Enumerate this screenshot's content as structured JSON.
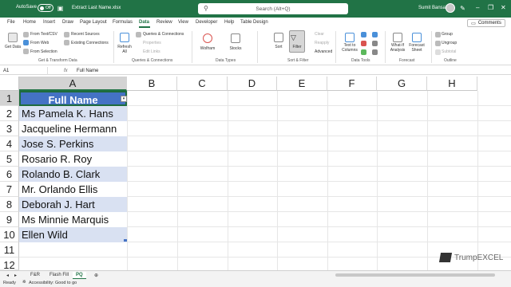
{
  "titlebar": {
    "autosave_label": "AutoSave",
    "autosave_state": "Off",
    "filename": "Extract Last Name.xlsx",
    "search_placeholder": "Search (Alt+Q)",
    "user_name": "Sumit Bansal",
    "accent": "#217346"
  },
  "tabs": [
    "File",
    "Home",
    "Insert",
    "Draw",
    "Page Layout",
    "Formulas",
    "Data",
    "Review",
    "View",
    "Developer",
    "Help",
    "Table Design"
  ],
  "active_tab": "Data",
  "comments_label": "Comments",
  "ribbon": {
    "get_data": "Get Data",
    "from_text_csv": "From Text/CSV",
    "from_web": "From Web",
    "from_selection": "From Selection",
    "recent_sources": "Recent Sources",
    "existing_connections": "Existing Connections",
    "group_get_transform": "Get & Transform Data",
    "refresh_all": "Refresh All",
    "queries_connections": "Queries & Connections",
    "properties": "Properties",
    "edit_links": "Edit Links",
    "group_queries": "Queries & Connections",
    "wolfram": "Wolfram",
    "stocks": "Stocks",
    "group_data_types": "Data Types",
    "sort": "Sort",
    "filter": "Filter",
    "clear": "Clear",
    "reapply": "Reapply",
    "advanced": "Advanced",
    "group_sort_filter": "Sort & Filter",
    "text_to_columns": "Text to Columns",
    "group_data_tools": "Data Tools",
    "what_if": "What-If Analysis",
    "forecast_sheet": "Forecast Sheet",
    "group_forecast": "Forecast",
    "group": "Group",
    "ungroup": "Ungroup",
    "subtotal": "Subtotal",
    "group_outline": "Outline"
  },
  "formula_bar": {
    "name_box": "A1",
    "fx": "fx",
    "value": "Full Name"
  },
  "columns": [
    "A",
    "B",
    "C",
    "D",
    "E",
    "F",
    "G",
    "H"
  ],
  "rows": [
    "1",
    "2",
    "3",
    "4",
    "5",
    "6",
    "7",
    "8",
    "9",
    "10",
    "11",
    "12"
  ],
  "table": {
    "header": "Full Name",
    "values": [
      "Ms Pamela K. Hans",
      "Jacqueline Hermann",
      "Jose S. Perkins",
      "Rosario R. Roy",
      "Rolando B. Clark",
      "Mr. Orlando Ellis",
      "Deborah J. Hart",
      "Ms Minnie Marquis",
      "Ellen Wild"
    ],
    "header_color": "#4472c4",
    "band_color": "#d9e1f2"
  },
  "sheets": [
    "F&R",
    "Flash Fill",
    "PQ"
  ],
  "active_sheet": "PQ",
  "status": {
    "ready": "Ready",
    "accessibility": "Accessibility: Good to go"
  },
  "watermark": "TrumpEXCEL"
}
